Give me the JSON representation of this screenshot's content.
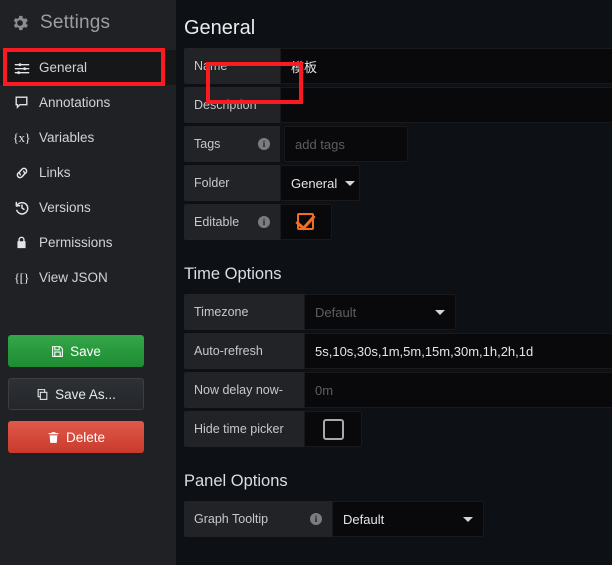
{
  "sidebar": {
    "title": "Settings",
    "gear_icon": "gear-icon",
    "items": [
      {
        "label": "General",
        "icon": "sliders-icon",
        "active": true
      },
      {
        "label": "Annotations",
        "icon": "comment-icon",
        "active": false
      },
      {
        "label": "Variables",
        "icon": "braces-x-icon",
        "active": false
      },
      {
        "label": "Links",
        "icon": "link-icon",
        "active": false
      },
      {
        "label": "Versions",
        "icon": "history-icon",
        "active": false
      },
      {
        "label": "Permissions",
        "icon": "lock-icon",
        "active": false
      },
      {
        "label": "View JSON",
        "icon": "brackets-icon",
        "active": false
      }
    ],
    "actions": [
      {
        "label": "Save",
        "icon": "save-icon",
        "style": "primary"
      },
      {
        "label": "Save As...",
        "icon": "copy-icon",
        "style": "secondary"
      },
      {
        "label": "Delete",
        "icon": "trash-icon",
        "style": "danger"
      }
    ]
  },
  "main": {
    "page_title": "General",
    "general": {
      "name": {
        "label": "Name",
        "value": "模板"
      },
      "description": {
        "label": "Description",
        "value": ""
      },
      "tags": {
        "label": "Tags",
        "placeholder": "add tags",
        "value": "",
        "info": "i"
      },
      "folder": {
        "label": "Folder",
        "value": "General"
      },
      "editable": {
        "label": "Editable",
        "checked": true,
        "info": "i"
      }
    },
    "time_options": {
      "title": "Time Options",
      "timezone": {
        "label": "Timezone",
        "value": "Default"
      },
      "auto_refresh": {
        "label": "Auto-refresh",
        "value": "5s,10s,30s,1m,5m,15m,30m,1h,2h,1d"
      },
      "now_delay": {
        "label": "Now delay now-",
        "placeholder": "0m",
        "value": ""
      },
      "hide_time_picker": {
        "label": "Hide time picker",
        "checked": false
      }
    },
    "panel_options": {
      "title": "Panel Options",
      "graph_tooltip": {
        "label": "Graph Tooltip",
        "value": "Default",
        "info": "i"
      }
    }
  },
  "highlights": {
    "color": "#fb1a21",
    "targets": [
      "sidebar-item-general",
      "name-label"
    ]
  },
  "colors": {
    "sidebar_bg": "#202124",
    "main_bg": "#0d1014",
    "label_bg": "#222326",
    "field_bg": "#09090b",
    "accent_orange": "#f06f20",
    "save_green": "#1f8c33",
    "delete_red": "#c93a2c",
    "highlight_red": "#fb1a21"
  }
}
